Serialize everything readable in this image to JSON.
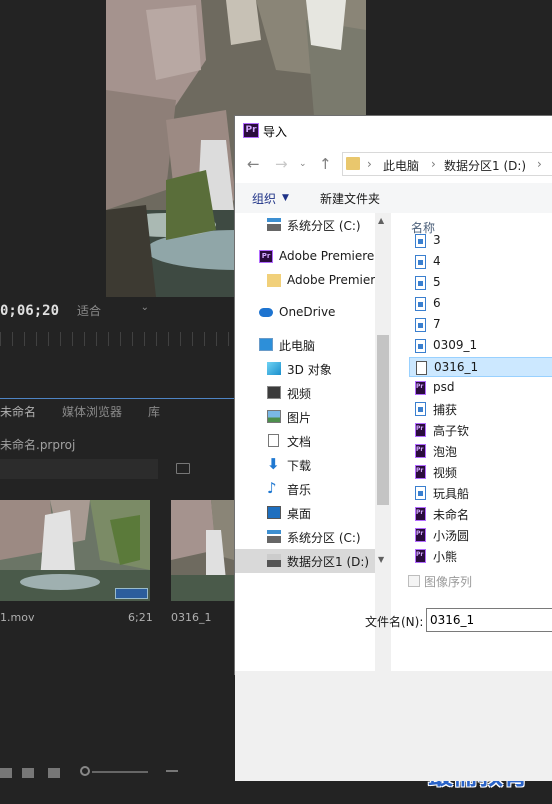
{
  "premiere": {
    "timecode": "0;06;20",
    "fit_dropdown": "适合",
    "tabs": [
      "未命名",
      "媒体浏览器",
      "库"
    ],
    "project_file": "未命名.prproj",
    "clips": [
      {
        "name": "1.mov",
        "duration": "6;21"
      },
      {
        "name": "0316_1",
        "duration": ""
      }
    ],
    "watermark": "最需教育"
  },
  "dialog": {
    "title": "导入",
    "app_badge": "Pr",
    "breadcrumb": [
      "此电脑",
      "数据分区1 (D:)"
    ],
    "toolbar": {
      "organize": "组织",
      "new_folder": "新建文件夹"
    },
    "nav_items": [
      {
        "label": "系统分区 (C:)",
        "icon": "drive-icon"
      },
      {
        "label": "Adobe Premiere",
        "icon": "premiere-icon"
      },
      {
        "label": "Adobe Premier",
        "icon": "folder-icon"
      },
      {
        "label": "OneDrive",
        "icon": "cloud-icon"
      },
      {
        "label": "此电脑",
        "icon": "computer-icon"
      },
      {
        "label": "3D 对象",
        "icon": "cube-icon"
      },
      {
        "label": "视频",
        "icon": "video-icon"
      },
      {
        "label": "图片",
        "icon": "picture-icon"
      },
      {
        "label": "文档",
        "icon": "document-icon"
      },
      {
        "label": "下载",
        "icon": "download-icon"
      },
      {
        "label": "音乐",
        "icon": "music-icon"
      },
      {
        "label": "桌面",
        "icon": "desktop-icon"
      },
      {
        "label": "系统分区 (C:)",
        "icon": "drive-icon"
      },
      {
        "label": "数据分区1 (D:)",
        "icon": "drive-icon"
      }
    ],
    "column_header": "名称",
    "files": [
      {
        "name": "3",
        "type": "image"
      },
      {
        "name": "4",
        "type": "image"
      },
      {
        "name": "5",
        "type": "image"
      },
      {
        "name": "6",
        "type": "image"
      },
      {
        "name": "7",
        "type": "image"
      },
      {
        "name": "0309_1",
        "type": "image"
      },
      {
        "name": "0316_1",
        "type": "document"
      },
      {
        "name": "psd",
        "type": "premiere"
      },
      {
        "name": "捕获",
        "type": "image"
      },
      {
        "name": "高子钦",
        "type": "premiere"
      },
      {
        "name": "泡泡",
        "type": "premiere"
      },
      {
        "name": "视频",
        "type": "premiere"
      },
      {
        "name": "玩具船",
        "type": "image"
      },
      {
        "name": "未命名",
        "type": "premiere"
      },
      {
        "name": "小汤圆",
        "type": "premiere"
      },
      {
        "name": "小熊",
        "type": "premiere"
      }
    ],
    "selected_file": "0316_1",
    "image_sequence_label": "图像序列",
    "filename_label": "文件名(N):",
    "filename_value": "0316_1"
  }
}
